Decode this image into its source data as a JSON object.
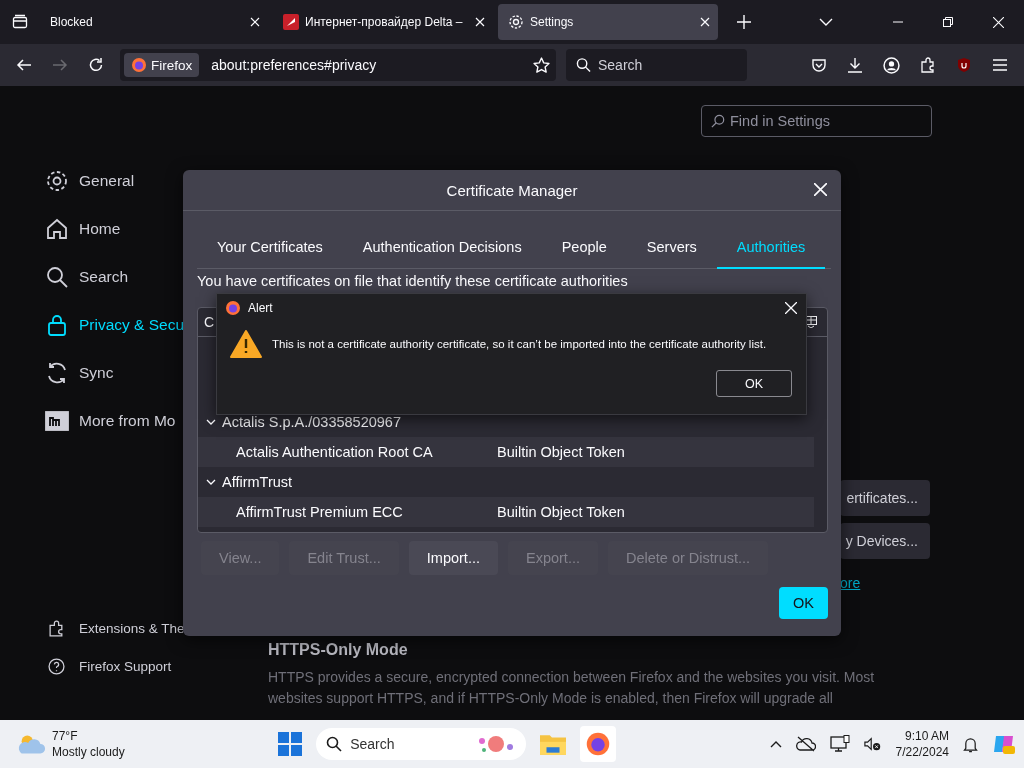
{
  "browser_tabs": [
    {
      "title": "Blocked",
      "selected": false
    },
    {
      "title": "Интернет-провайдер Delta –",
      "selected": false
    },
    {
      "title": "Settings",
      "selected": true
    }
  ],
  "nav": {
    "identity": "Firefox",
    "url": "about:preferences#privacy",
    "search_placeholder": "Search",
    "forward_disabled": true
  },
  "settings": {
    "search_placeholder": "Find in Settings",
    "categories": [
      {
        "label": "General",
        "selected": false
      },
      {
        "label": "Home",
        "selected": false
      },
      {
        "label": "Search",
        "selected": false
      },
      {
        "label": "Privacy & Secu",
        "selected": true
      },
      {
        "label": "Sync",
        "selected": false
      },
      {
        "label": "More from Mo",
        "selected": false
      }
    ],
    "footer_links": [
      "Extensions & The",
      "Firefox Support"
    ],
    "side_buttons": [
      "ertificates...",
      "y Devices..."
    ],
    "link": "ore",
    "section": {
      "heading": "HTTPS-Only Mode",
      "text": "HTTPS provides a secure, encrypted connection between Firefox and the websites you visit. Most websites support HTTPS, and if HTTPS-Only Mode is enabled, then Firefox will upgrade all"
    }
  },
  "certificate_manager": {
    "title": "Certificate Manager",
    "tabs": [
      {
        "label": "Your Certificates",
        "selected": false
      },
      {
        "label": "Authentication Decisions",
        "selected": false
      },
      {
        "label": "People",
        "selected": false
      },
      {
        "label": "Servers",
        "selected": false
      },
      {
        "label": "Authorities",
        "selected": true
      }
    ],
    "description": "You have certificates on file that identify these certificate authorities",
    "columns": [
      "C"
    ],
    "rows": [
      {
        "kind": "group",
        "label": "Actalis S.p.A./03358520967",
        "expanded": true
      },
      {
        "kind": "cert",
        "name": "Actalis Authentication Root CA",
        "token": "Builtin Object Token"
      },
      {
        "kind": "group",
        "label": "AffirmTrust",
        "expanded": true
      },
      {
        "kind": "cert",
        "name": "AffirmTrust Premium ECC",
        "token": "Builtin Object Token"
      }
    ],
    "buttons": [
      {
        "label": "View...",
        "disabled": true
      },
      {
        "label": "Edit Trust...",
        "disabled": true
      },
      {
        "label": "Import...",
        "disabled": false
      },
      {
        "label": "Export...",
        "disabled": true
      },
      {
        "label": "Delete or Distrust...",
        "disabled": true
      }
    ],
    "ok": "OK"
  },
  "alert": {
    "title": "Alert",
    "message": "This is not a certificate authority certificate, so it can’t be imported into the certificate authority list.",
    "ok": "OK"
  },
  "taskbar": {
    "temperature": "77°F",
    "weather": "Mostly cloudy",
    "search_placeholder": "Search",
    "time": "9:10 AM",
    "date": "7/22/2024"
  }
}
